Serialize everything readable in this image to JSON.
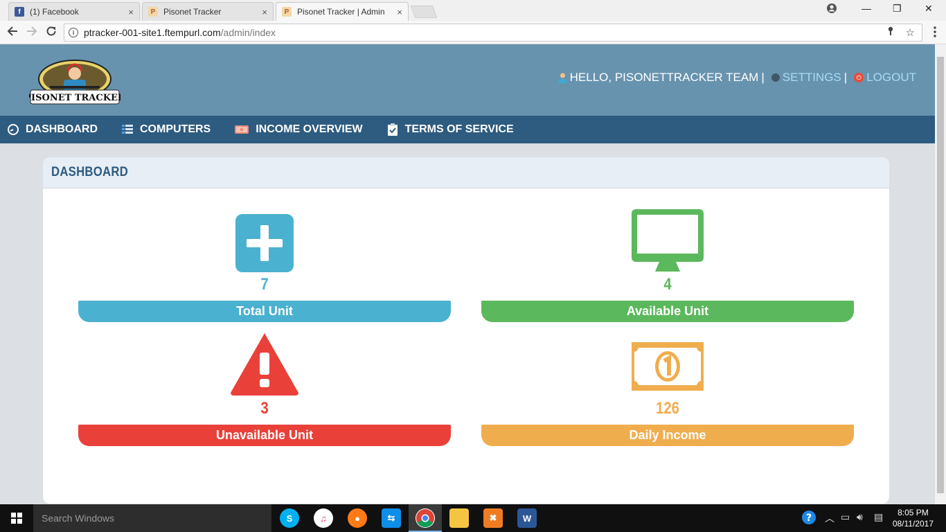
{
  "browser": {
    "tabs": [
      {
        "label": "(1) Facebook",
        "close": "×",
        "favicon": "facebook-icon"
      },
      {
        "label": "Pisonet Tracker",
        "close": "×",
        "favicon": "pisonet-icon"
      },
      {
        "label": "Pisonet Tracker | Admin",
        "close": "×",
        "favicon": "pisonet-icon"
      }
    ],
    "url_host": "ptracker-001-site1.ftempurl.com",
    "url_path": "/admin/index",
    "window_controls": [
      "—",
      "❐",
      "✕"
    ]
  },
  "header": {
    "logo_text": "PISONET TRACKER",
    "greeting": "HELLO, PISONETTRACKER TEAM",
    "separator": "|",
    "settings": "SETTINGS",
    "logout": "LOGOUT"
  },
  "nav": {
    "items": [
      {
        "label": "DASHBOARD",
        "icon": "dashboard-icon"
      },
      {
        "label": "COMPUTERS",
        "icon": "computers-icon"
      },
      {
        "label": "INCOME OVERVIEW",
        "icon": "income-icon"
      },
      {
        "label": "TERMS OF SERVICE",
        "icon": "clipboard-icon"
      }
    ]
  },
  "dashboard": {
    "title": "DASHBOARD",
    "stats": [
      {
        "value": "7",
        "label": "Total Unit",
        "color": "#4bb1d0",
        "icon": "plus-icon"
      },
      {
        "value": "4",
        "label": "Available Unit",
        "color": "#5cb85c",
        "icon": "monitor-icon"
      },
      {
        "value": "3",
        "label": "Unavailable Unit",
        "color": "#e9413a",
        "icon": "warning-icon"
      },
      {
        "value": "126",
        "label": "Daily Income",
        "color": "#f0ad4e",
        "icon": "money-icon"
      }
    ]
  },
  "taskbar": {
    "search_placeholder": "Search Windows",
    "time": "8:05 PM",
    "date": "08/11/2017"
  }
}
